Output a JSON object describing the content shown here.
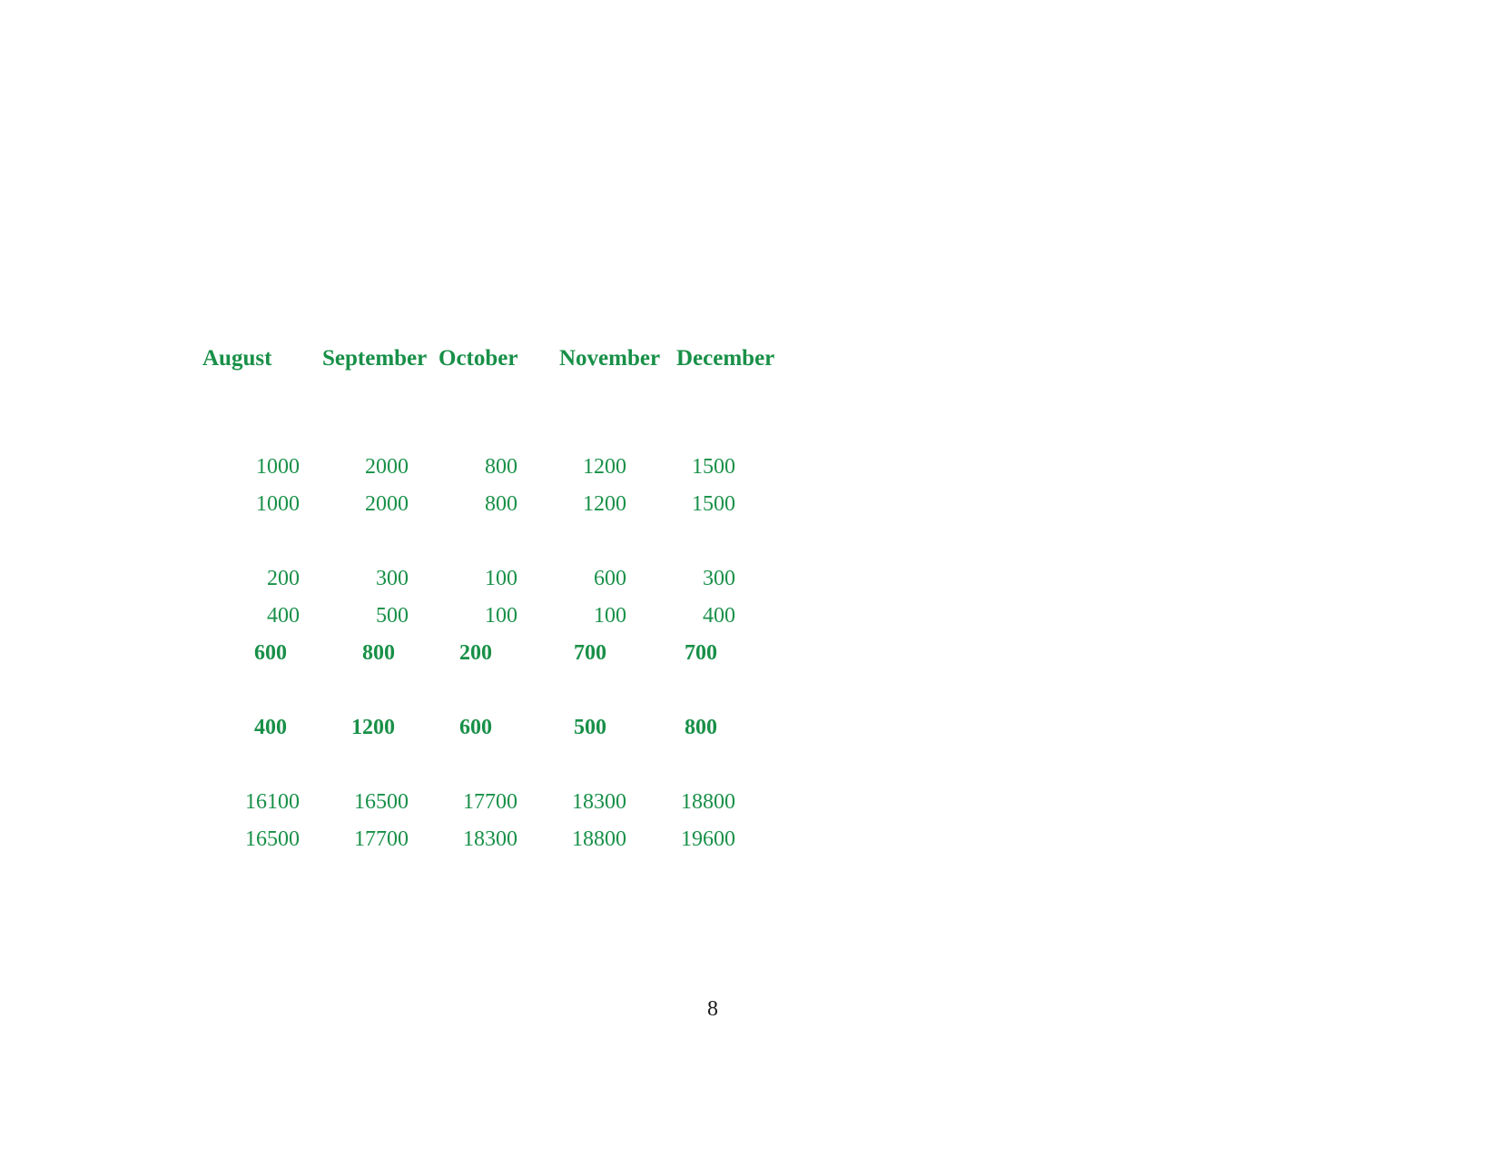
{
  "page": {
    "page_number": "8",
    "background_color": "#ffffff",
    "accent_color": "#189048",
    "page_number_color": "#1a1a1a"
  },
  "table": {
    "columns": [
      {
        "key": "label",
        "header": ""
      },
      {
        "key": "august",
        "header": "August"
      },
      {
        "key": "september",
        "header": "September"
      },
      {
        "key": "october",
        "header": "October"
      },
      {
        "key": "november",
        "header": "November"
      },
      {
        "key": "december",
        "header": "December"
      }
    ],
    "rows": [
      {
        "type": "spacer",
        "bold": false,
        "cells": [
          "",
          "",
          "",
          "",
          "",
          ""
        ]
      },
      {
        "type": "spacer",
        "bold": false,
        "cells": [
          "",
          "",
          "",
          "",
          "",
          ""
        ]
      },
      {
        "type": "data",
        "bold": false,
        "cells": [
          "",
          "1000",
          "2000",
          "800",
          "1200",
          "1500"
        ]
      },
      {
        "type": "data",
        "bold": false,
        "cells": [
          "",
          "1000",
          "2000",
          "800",
          "1200",
          "1500"
        ]
      },
      {
        "type": "spacer",
        "bold": false,
        "cells": [
          "",
          "",
          "",
          "",
          "",
          ""
        ]
      },
      {
        "type": "data",
        "bold": false,
        "cells": [
          "",
          "200",
          "300",
          "100",
          "600",
          "300"
        ]
      },
      {
        "type": "data",
        "bold": false,
        "cells": [
          "",
          "400",
          "500",
          "100",
          "100",
          "400"
        ]
      },
      {
        "type": "data",
        "bold": true,
        "cells": [
          "",
          "600",
          "800",
          "200",
          "700",
          "700"
        ]
      },
      {
        "type": "spacer",
        "bold": false,
        "cells": [
          "",
          "",
          "",
          "",
          "",
          ""
        ]
      },
      {
        "type": "data",
        "bold": true,
        "cells": [
          "",
          "400",
          "1200",
          "600",
          "500",
          "800"
        ]
      },
      {
        "type": "spacer",
        "bold": false,
        "cells": [
          "",
          "",
          "",
          "",
          "",
          ""
        ]
      },
      {
        "type": "data",
        "bold": false,
        "cells": [
          "",
          "16100",
          "16500",
          "17700",
          "18300",
          "18800"
        ]
      },
      {
        "type": "data",
        "bold": false,
        "cells": [
          "",
          "16500",
          "17700",
          "18300",
          "18800",
          "19600"
        ]
      }
    ]
  },
  "chart_data": {
    "type": "table",
    "title": "",
    "categories": [
      "August",
      "September",
      "October",
      "November",
      "December"
    ],
    "series": [
      {
        "name": "row-1",
        "bold": false,
        "values": [
          1000,
          2000,
          800,
          1200,
          1500
        ]
      },
      {
        "name": "row-2",
        "bold": false,
        "values": [
          1000,
          2000,
          800,
          1200,
          1500
        ]
      },
      {
        "name": "row-3",
        "bold": false,
        "values": [
          200,
          300,
          100,
          600,
          300
        ]
      },
      {
        "name": "row-4",
        "bold": false,
        "values": [
          400,
          500,
          100,
          100,
          400
        ]
      },
      {
        "name": "row-5-total",
        "bold": true,
        "values": [
          600,
          800,
          200,
          700,
          700
        ]
      },
      {
        "name": "row-6-total",
        "bold": true,
        "values": [
          400,
          1200,
          600,
          500,
          800
        ]
      },
      {
        "name": "row-7",
        "bold": false,
        "values": [
          16100,
          16500,
          17700,
          18300,
          18800
        ]
      },
      {
        "name": "row-8",
        "bold": false,
        "values": [
          16500,
          17700,
          18300,
          18800,
          19600
        ]
      }
    ],
    "xlabel": "",
    "ylabel": "",
    "grid": false,
    "legend_position": "none"
  }
}
